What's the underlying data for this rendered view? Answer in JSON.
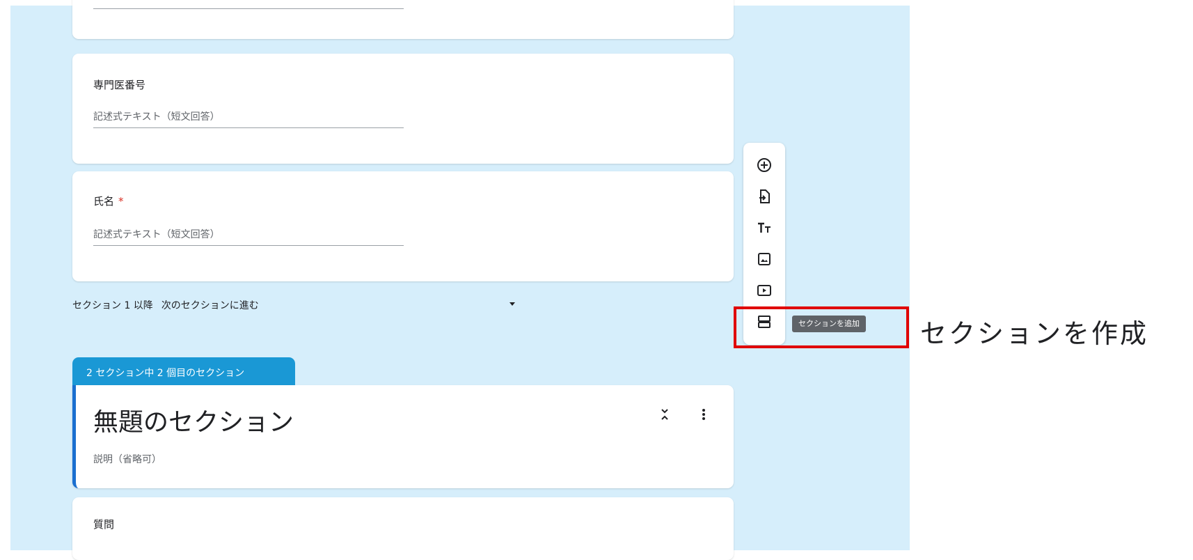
{
  "questions": [
    {
      "title": "専門医番号",
      "required": false,
      "answer_placeholder": "記述式テキスト（短文回答）"
    },
    {
      "title": "氏名",
      "required": true,
      "required_mark": "*",
      "answer_placeholder": "記述式テキスト（短文回答）"
    }
  ],
  "section_nav": {
    "label": "セクション 1 以降",
    "value": "次のセクションに進む"
  },
  "section2": {
    "tab_label": "2 セクション中 2 個目のセクション",
    "title": "無題のセクション",
    "description": "説明（省略可）"
  },
  "next_question": {
    "title": "質問"
  },
  "toolbar": {
    "buttons": [
      {
        "name": "add-question-icon"
      },
      {
        "name": "import-questions-icon"
      },
      {
        "name": "add-title-icon"
      },
      {
        "name": "add-image-icon"
      },
      {
        "name": "add-video-icon"
      },
      {
        "name": "add-section-icon"
      }
    ],
    "tooltip": "セクションを追加"
  },
  "callout": {
    "text": "セクションを作成",
    "highlight_color": "#e00000"
  },
  "colors": {
    "background": "#d6eefb",
    "section_tab": "#1a98d5",
    "section_accent": "#1a6fd0",
    "required": "#d93025"
  }
}
